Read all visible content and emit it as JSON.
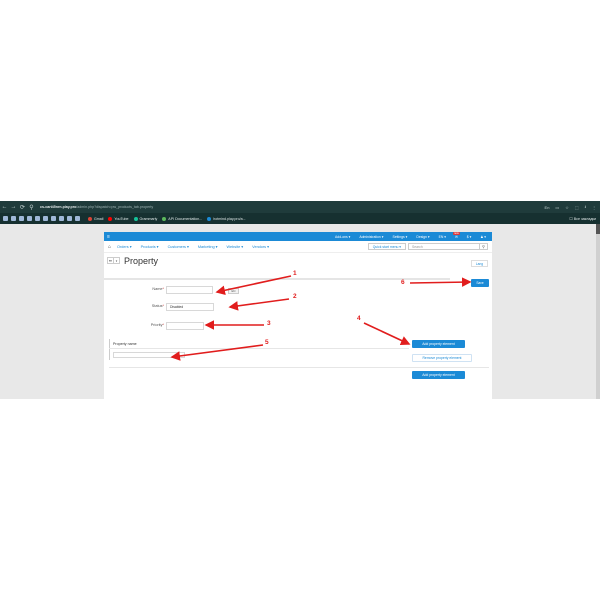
{
  "browser": {
    "url_main": "cs-cart45nrn.play.pro",
    "url_rest": "/admin.php?dispatch=pw_products_tab.property",
    "nav": [
      "←",
      "→",
      "⟳",
      "⚲"
    ],
    "right_icons": [
      "En",
      "▭",
      "☆",
      "⬚",
      "⭳",
      "⋮"
    ]
  },
  "bookmarks": {
    "items": [
      {
        "label": "Gmail",
        "color": "#db4437"
      },
      {
        "label": "YouTube",
        "color": "#ff0000"
      },
      {
        "label": "Grammarly",
        "color": "#15c39a"
      },
      {
        "label": "API Documentation...",
        "color": "#5cb85c"
      },
      {
        "label": "hotmind.play.pro/a...",
        "color": "#1b8ad6"
      }
    ],
    "all_bookmarks": "☐ Все закладки"
  },
  "topnav": {
    "menu_icon": "≡",
    "items": [
      "Add-ons ▾",
      "Administration ▾",
      "Settings ▾",
      "Design ▾",
      "EN ▾",
      "$ ▾",
      "♟ ▾"
    ],
    "badge": "new"
  },
  "subnav": {
    "home_icon": "⌂",
    "items": [
      "Orders ▾",
      "Products ▾",
      "Customers ▾",
      "Marketing ▾",
      "Website ▾",
      "Vendors ▾"
    ],
    "quick_start": "Quick start menu ▾",
    "search_placeholder": "Search",
    "search_icon": "⚲"
  },
  "page": {
    "back_icon": "⇚",
    "caret": "▾",
    "title": "Property",
    "subtab": "Lang",
    "save": "Save"
  },
  "form": {
    "name_label": "Name",
    "name_value": "",
    "lang_tag": "EN",
    "status_label": "Status",
    "status_value": "Disabled",
    "priority_label": "Priority",
    "priority_value": "",
    "required_mark": "*"
  },
  "table": {
    "header": "Property name",
    "row_value": "",
    "add_label": "Add property element",
    "remove_label": "Remove property element",
    "add_bottom_label": "Add property element"
  },
  "annotations": [
    "1",
    "2",
    "3",
    "4",
    "5",
    "6"
  ],
  "colors": {
    "accent": "#1b8ad6",
    "arrow": "#e11d1d",
    "chrome": "#1f3b3b"
  }
}
